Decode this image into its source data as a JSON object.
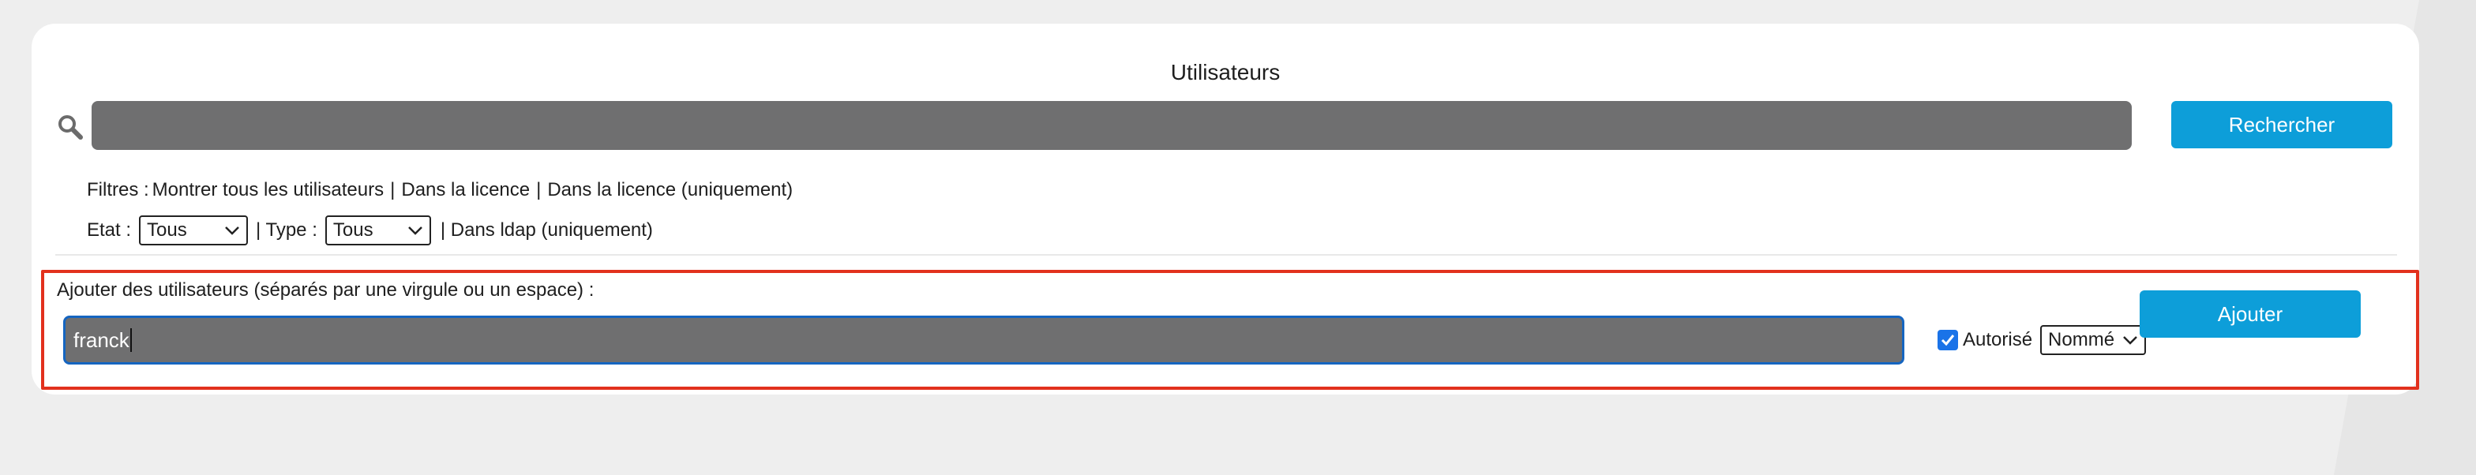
{
  "panel": {
    "title": "Utilisateurs"
  },
  "search": {
    "icon": "search-icon",
    "value": "",
    "placeholder": "",
    "button_label": "Rechercher"
  },
  "filters": {
    "label": "Filtres :",
    "show_all": "Montrer tous les utilisateurs",
    "separator": "|",
    "in_license": "Dans la licence",
    "in_license_only": "Dans la licence (uniquement)"
  },
  "state": {
    "etat_label": "Etat :",
    "etat_value": "Tous",
    "type_label": "| Type :",
    "type_value": "Tous",
    "ldap_only": "| Dans ldap (uniquement)"
  },
  "add_users": {
    "label": "Ajouter des utilisateurs (séparés par une virgule ou un espace) :",
    "value": "franck",
    "authorized_checked": true,
    "authorized_label": "Autorisé",
    "role_value": "Nommé",
    "button_label": "Ajouter"
  },
  "colors": {
    "accent": "#0d9ed9",
    "field_bg": "#6f6f70",
    "highlight_border": "#e2311d",
    "focus_border": "#1565c0"
  }
}
